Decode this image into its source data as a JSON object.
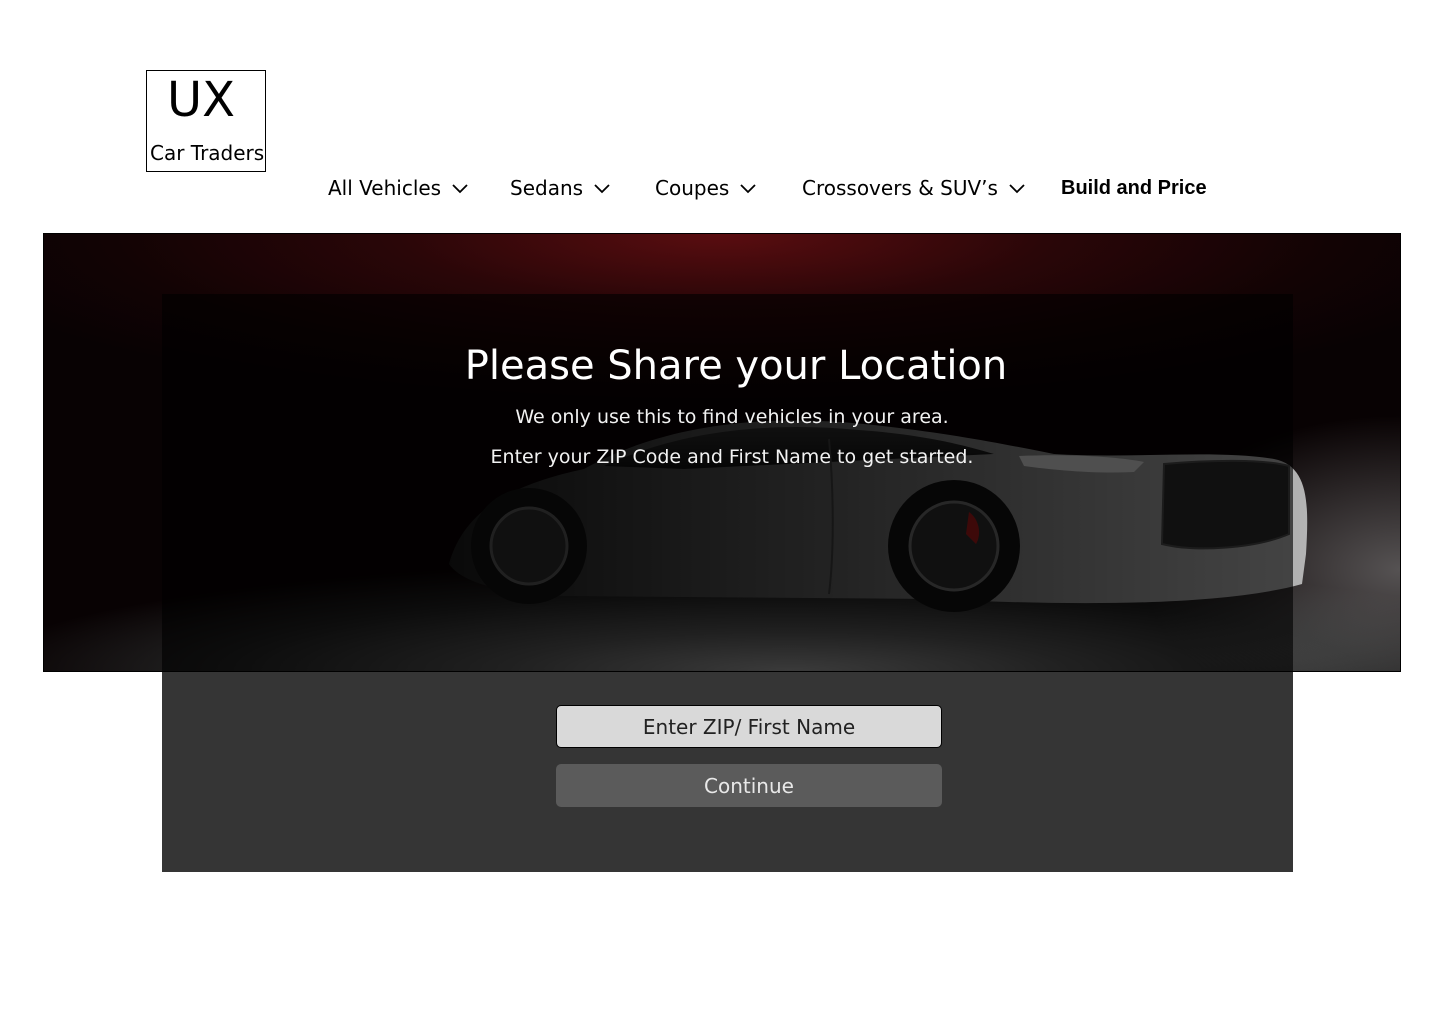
{
  "logo": {
    "mark": "UX",
    "name": "Car Traders"
  },
  "nav": {
    "items": [
      {
        "label": "All Vehicles",
        "has_dropdown": true
      },
      {
        "label": "Sedans",
        "has_dropdown": true
      },
      {
        "label": "Coupes",
        "has_dropdown": true
      },
      {
        "label": "Crossovers & SUV’s",
        "has_dropdown": true
      },
      {
        "label": "Build and Price",
        "has_dropdown": false
      }
    ],
    "chevron_icon": "chevron-down-icon"
  },
  "hero": {
    "image": "dark-sports-coupe-photo",
    "accent_color": "#5a0d10"
  },
  "location_prompt": {
    "title": "Please Share your Location",
    "line1": "We only use this to find vehicles in your area.",
    "line2": "Enter your ZIP Code and First Name to get started.",
    "input_placeholder": "Enter ZIP/ First Name",
    "input_value": "",
    "button_label": "Continue"
  },
  "colors": {
    "panel_overlay": "rgba(0,0,0,0.62)",
    "panel_bottom": "#353535",
    "input_bg": "#d9d9d9",
    "button_bg": "#5b5b5b"
  }
}
